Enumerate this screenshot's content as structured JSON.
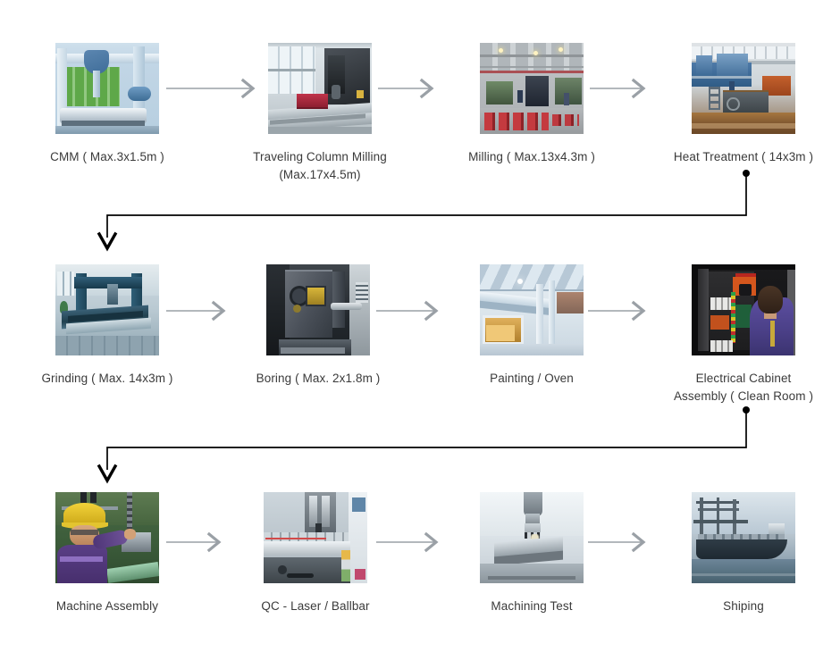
{
  "diagram": {
    "title": "Manufacturing Process Flow",
    "colors": {
      "arrow": "#9aa0a6",
      "wrap_connector": "#000000",
      "caption_text": "#3a3a3a",
      "background": "#ffffff"
    }
  },
  "rows": [
    {
      "steps": [
        {
          "label": "CMM ( Max.3x1.5m )",
          "image": "cmm-machine-photo"
        },
        {
          "label": "Traveling Column Milling\n(Max.17x4.5m)",
          "image": "traveling-column-milling-photo"
        },
        {
          "label": "Milling ( Max.13x4.3m )",
          "image": "milling-workshop-photo"
        },
        {
          "label": "Heat Treatment ( 14x3m )",
          "image": "heat-treatment-photo"
        }
      ]
    },
    {
      "steps": [
        {
          "label": "Grinding ( Max. 14x3m )",
          "image": "grinding-machine-photo"
        },
        {
          "label": "Boring ( Max. 2x1.8m )",
          "image": "boring-machine-photo"
        },
        {
          "label": "Painting / Oven",
          "image": "painting-oven-photo"
        },
        {
          "label": "Electrical Cabinet\nAssembly ( Clean Room )",
          "image": "electrical-cabinet-photo"
        }
      ]
    },
    {
      "steps": [
        {
          "label": "Machine Assembly",
          "image": "machine-assembly-photo"
        },
        {
          "label": "QC - Laser / Ballbar",
          "image": "qc-laser-ballbar-photo"
        },
        {
          "label": "Machining Test",
          "image": "machining-test-photo"
        },
        {
          "label": "Shiping",
          "image": "shipping-vessel-photo"
        }
      ]
    }
  ]
}
